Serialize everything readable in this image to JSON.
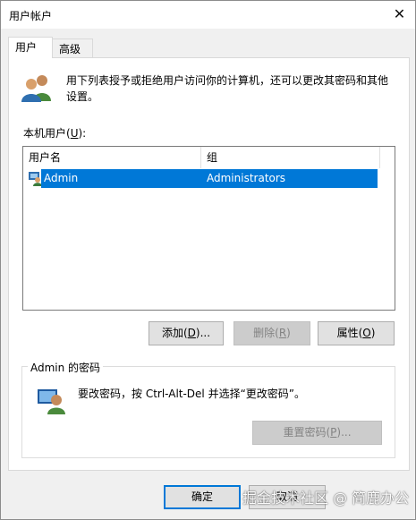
{
  "window": {
    "title": "用户帐户"
  },
  "tabs": [
    {
      "label": "用户",
      "active": true
    },
    {
      "label": "高级",
      "active": false
    }
  ],
  "intro_text": "用下列表授予或拒绝用户访问你的计算机，还可以更改其密码和其他设置。",
  "local_users": {
    "label_prefix": "本机用户(",
    "label_key": "U",
    "label_suffix": "):",
    "columns": [
      "用户名",
      "组"
    ],
    "rows": [
      {
        "name": "Admin",
        "group": "Administrators",
        "selected": true
      }
    ]
  },
  "buttons": {
    "add": {
      "prefix": "添加(",
      "key": "D",
      "suffix": ")..."
    },
    "remove": {
      "prefix": "删除(",
      "key": "R",
      "suffix": ")"
    },
    "properties": {
      "prefix": "属性(",
      "key": "O",
      "suffix": ")"
    },
    "reset_password": {
      "prefix": "重置密码(",
      "key": "P",
      "suffix": ")..."
    },
    "ok": "确定",
    "cancel": "取消"
  },
  "password_group": {
    "title": "Admin 的密码",
    "text": "要改密码，按 Ctrl-Alt-Del 并选择“更改密码”。"
  },
  "watermark": "掘金技术社区 @ 简鹿办公",
  "colors": {
    "selection": "#0078d7",
    "default_button_border": "#0078d7"
  }
}
